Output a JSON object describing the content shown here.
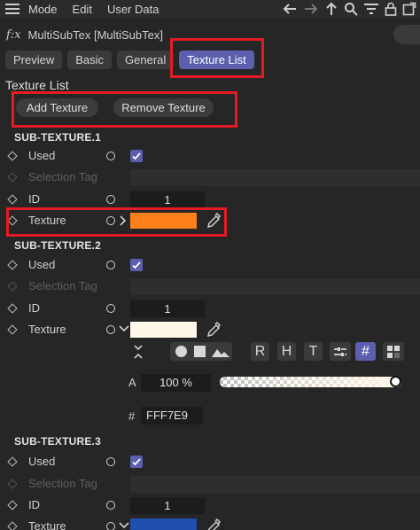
{
  "menu": {
    "items": [
      "Mode",
      "Edit",
      "User Data"
    ]
  },
  "title": {
    "fx": "f:x",
    "object": "MultiSubTex [MultiSubTex]"
  },
  "tabs": [
    "Preview",
    "Basic",
    "General",
    "Texture List"
  ],
  "active_tab": "Texture List",
  "section_title": "Texture List",
  "buttons": {
    "add": "Add Texture",
    "remove": "Remove Texture"
  },
  "sub_textures": [
    {
      "header": "SUB-TEXTURE.1",
      "used_label": "Used",
      "used": true,
      "tag_label": "Selection Tag",
      "id_label": "ID",
      "id_value": "1",
      "texture_label": "Texture",
      "color": "#FF7F1A"
    },
    {
      "header": "SUB-TEXTURE.2",
      "used_label": "Used",
      "used": true,
      "tag_label": "Selection Tag",
      "id_label": "ID",
      "id_value": "1",
      "texture_label": "Texture",
      "color": "#FFF7E9"
    },
    {
      "header": "SUB-TEXTURE.3",
      "used_label": "Used",
      "used": true,
      "tag_label": "Selection Tag",
      "id_label": "ID",
      "id_value": "1",
      "texture_label": "Texture",
      "color": "#1E4FB0"
    }
  ],
  "color_picker": {
    "modes": [
      "R",
      "H",
      "T",
      "#"
    ],
    "active_mode": "#",
    "alpha_label": "A",
    "alpha_value": "100 %",
    "alpha_fraction": 1.0,
    "hex_label": "#",
    "hex_value": "FFF7E9"
  },
  "icons": [
    "hamburger-icon",
    "back-arrow-icon",
    "forward-arrow-icon",
    "up-arrow-icon",
    "search-icon",
    "filter-icon",
    "lock-icon",
    "new-window-icon",
    "eyedropper-icon",
    "circle-icon",
    "square-icon",
    "image-icon",
    "mixer-icon",
    "swatches-icon",
    "expand-collapse-icon"
  ],
  "colors": {
    "accent": "#5B5FAD",
    "annotation": "#E31B23",
    "background": "#262626"
  }
}
